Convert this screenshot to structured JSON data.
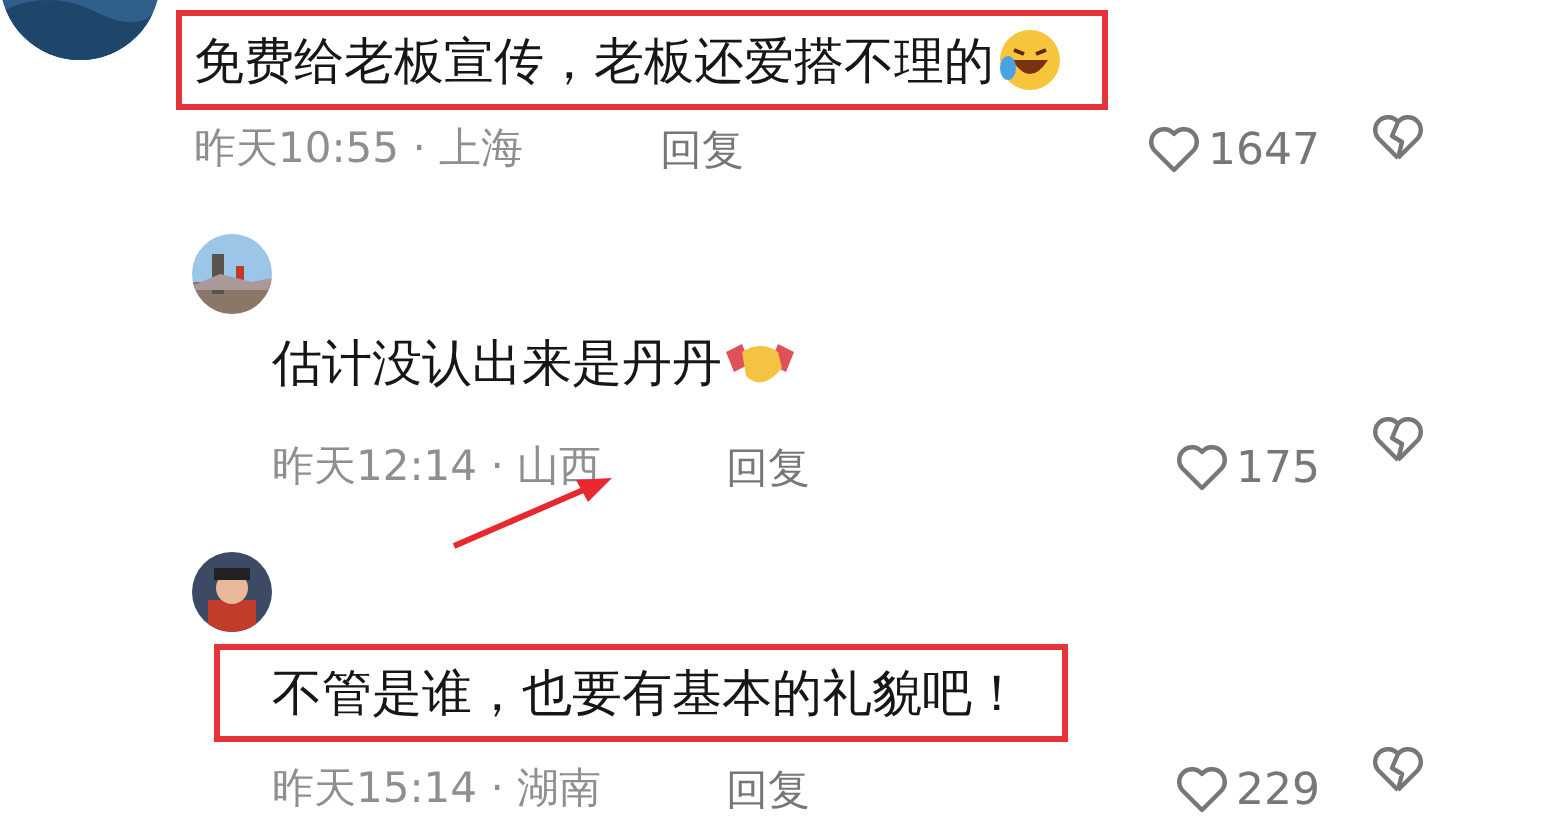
{
  "comments": [
    {
      "kind": "comment",
      "text": "免费给老板宣传，老板还爱搭不理的",
      "highlighted": true,
      "annotated": false,
      "meta": "昨天10:55 · 上海",
      "reply_label": "回复",
      "likes": "1647"
    },
    {
      "kind": "reply",
      "text": "估计没认出来是丹丹",
      "highlighted": false,
      "annotated": true,
      "meta": "昨天12:14 · 山西",
      "reply_label": "回复",
      "likes": "175"
    },
    {
      "kind": "reply",
      "text": "不管是谁，也要有基本的礼貌吧！",
      "highlighted": true,
      "annotated": false,
      "meta": "昨天15:14 · 湖南",
      "reply_label": "回复",
      "likes": "229"
    }
  ]
}
